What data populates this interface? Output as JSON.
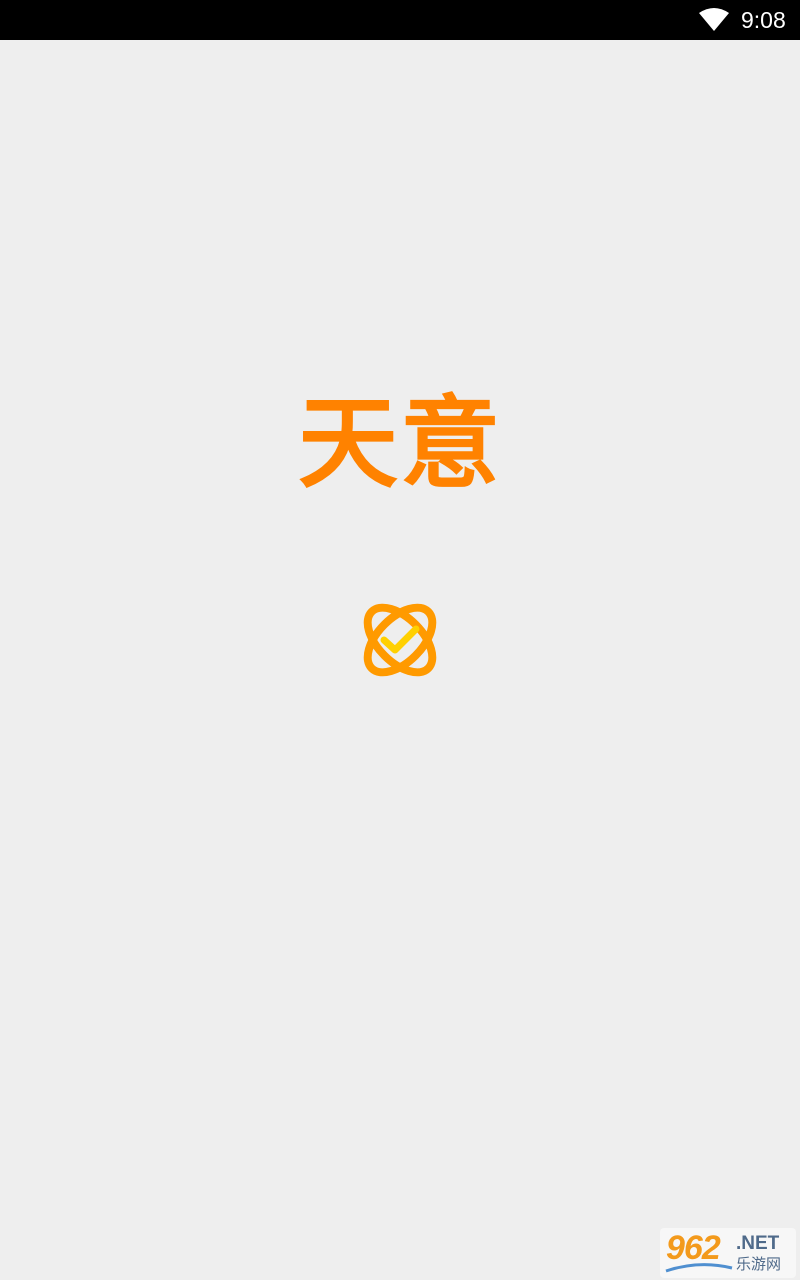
{
  "status_bar": {
    "time": "9:08",
    "wifi_icon": "wifi-icon"
  },
  "splash": {
    "app_name": "天意",
    "logo_icon": "orbit-check-logo-icon"
  },
  "watermark": {
    "number": "962",
    "suffix": ".NET",
    "chinese": "乐游网"
  },
  "colors": {
    "background": "#eeeeee",
    "status_bar": "#000000",
    "brand_orange": "#ff8200",
    "logo_orange": "#ff9a00",
    "check_yellow": "#ffd000"
  }
}
